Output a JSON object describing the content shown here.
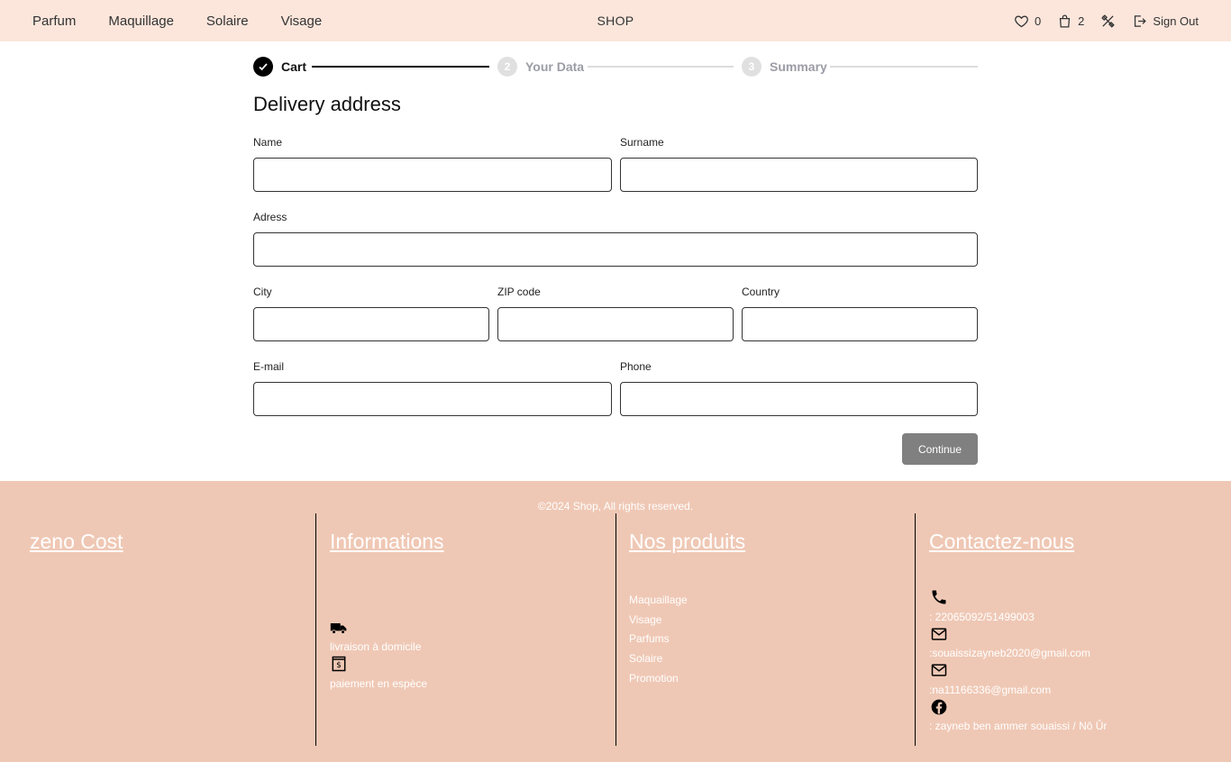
{
  "nav": {
    "links": [
      "Parfum",
      "Maquillage",
      "Solaire",
      "Visage"
    ],
    "brand": "SHOP",
    "wishlist_count": "0",
    "cart_count": "2",
    "signout_label": "Sign Out"
  },
  "stepper": {
    "steps": [
      {
        "number": "1",
        "label": "Cart",
        "state": "done"
      },
      {
        "number": "2",
        "label": "Your Data",
        "state": "todo"
      },
      {
        "number": "3",
        "label": "Summary",
        "state": "todo"
      }
    ]
  },
  "form": {
    "title": "Delivery address",
    "fields": {
      "name": {
        "label": "Name",
        "value": ""
      },
      "surname": {
        "label": "Surname",
        "value": ""
      },
      "address": {
        "label": "Adress",
        "value": ""
      },
      "city": {
        "label": "City",
        "value": ""
      },
      "zip": {
        "label": "ZIP code",
        "value": ""
      },
      "country": {
        "label": "Country",
        "value": ""
      },
      "email": {
        "label": "E-mail",
        "value": ""
      },
      "phone": {
        "label": "Phone",
        "value": ""
      }
    },
    "continue_label": "Continue"
  },
  "footer": {
    "copyright": "©2024 Shop, All rights reserved.",
    "brand_title": "zeno Cost",
    "info": {
      "title": "Informations",
      "delivery": "livraison à domicile",
      "payment": "paiement en espèce"
    },
    "products": {
      "title": "Nos produits",
      "items": [
        "Maquaillage",
        "Visage",
        "Parfums",
        "Solaire",
        "Promotion"
      ]
    },
    "contact": {
      "title": "Contactez-nous",
      "phone": ": 22065092/51499003",
      "email1": ":souaissizayneb2020@gmail.com",
      "email2": ":na11166336@gmail.com",
      "facebook": ": zayneb ben ammer souaissi / Nô Ûr"
    }
  },
  "colors": {
    "nav_bg": "#fce6dc",
    "footer_bg": "#efc8b5",
    "button_bg": "#808080"
  }
}
